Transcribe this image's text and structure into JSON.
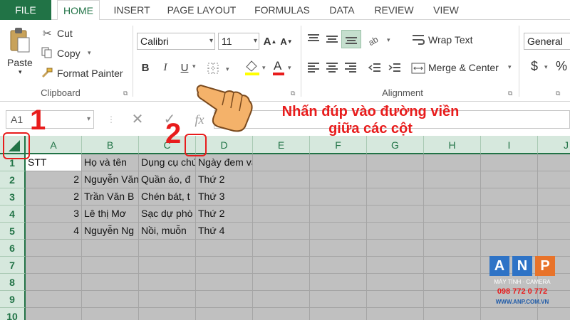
{
  "tabs": [
    "FILE",
    "HOME",
    "INSERT",
    "PAGE LAYOUT",
    "FORMULAS",
    "DATA",
    "REVIEW",
    "VIEW"
  ],
  "clipboard": {
    "paste": "Paste",
    "cut": "Cut",
    "copy": "Copy",
    "format_painter": "Format Painter",
    "group_label": "Clipboard"
  },
  "font": {
    "name": "Calibri",
    "size": "11",
    "bold": "B",
    "italic": "I",
    "underline": "U",
    "font_color_glyph": "A"
  },
  "alignment": {
    "wrap_text": "Wrap Text",
    "merge_center": "Merge & Center",
    "group_label": "Alignment"
  },
  "number": {
    "format": "General",
    "currency": "$",
    "percent": "%"
  },
  "formula_bar": {
    "name_box": "A1",
    "cancel_glyph": "✕",
    "enter_glyph": "✓",
    "fx_glyph": "fx"
  },
  "columns": [
    "A",
    "B",
    "C",
    "D",
    "E",
    "F",
    "G",
    "H",
    "I",
    "J"
  ],
  "rows": [
    "1",
    "2",
    "3",
    "4",
    "5",
    "6",
    "7",
    "8",
    "9",
    "10"
  ],
  "cells": [
    [
      "STT",
      "Họ và tên",
      "Dụng cụ chứa",
      "Ngày đem vào kho"
    ],
    [
      "2",
      "Nguyễn Văn",
      "Quần áo, đ",
      "Thứ 2"
    ],
    [
      "2",
      "Trần Văn B",
      "Chén bát, t",
      "Thứ 3"
    ],
    [
      "3",
      "Lê thị Mơ",
      "Sạc dự phò",
      "Thứ 2"
    ],
    [
      "4",
      "Nguyễn Ng",
      "Nồi, muỗn",
      "Thứ 4"
    ]
  ],
  "annotations": {
    "step1": "1",
    "step2": "2",
    "instruction_line1": "Nhấn đúp vào đường viền",
    "instruction_line2": "giữa các cột"
  },
  "logo": {
    "letters": [
      "A",
      "N",
      "P"
    ],
    "line1": "MÁY TÍNH · CAMERA",
    "phone": "098 772 0 772",
    "url": "WWW.ANP.COM.VN"
  },
  "colors": {
    "excel_green": "#217346",
    "annotation_red": "#e81c1c",
    "selection_gray": "#c0c0c0"
  }
}
